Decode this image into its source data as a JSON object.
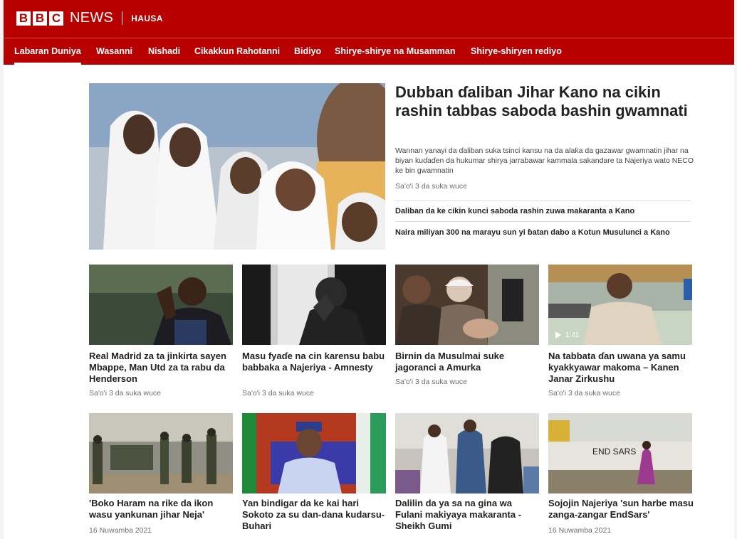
{
  "brand": {
    "b1": "B",
    "b2": "B",
    "b3": "C",
    "news": "NEWS",
    "lang": "HAUSA"
  },
  "nav": [
    {
      "label": "Labaran Duniya",
      "active": true
    },
    {
      "label": "Wasanni"
    },
    {
      "label": "Nishadi"
    },
    {
      "label": "Cikakkun Rahotanni"
    },
    {
      "label": "Bidiyo"
    },
    {
      "label": "Shirye-shirye na Musamman"
    },
    {
      "label": "Shirye-shiryen rediyo"
    }
  ],
  "top_story": {
    "headline": "Dubban ɗaliban Jihar Kano na cikin rashin tabbas saboda bashin gwamnati",
    "summary": "Wannan yanayi da ɗaliban suka tsinci kansu na da alaƙa da gazawar gwamnatin jihar na biyan kuɗaɗen da hukumar shirya jarrabawar kammala sakandare ta Najeriya wato NECO ke bin gwamnatin",
    "timestamp": "Sa'o'i 3 da suka wuce",
    "related": [
      "Daliban da ke cikin kunci saboda rashin zuwa makaranta a Kano",
      "Naira miliyan 300 na marayu sun yi ɓatan dabo a Kotun Musulunci a Kano"
    ]
  },
  "row1": [
    {
      "title": "Real Madrid za ta jinkirta sayen Mbappe, Man Utd za ta rabu da Henderson",
      "timestamp": "Sa'o'i 3 da suka wuce"
    },
    {
      "title": "Masu fyaɗe na cin karensu babu babbaka a Najeriya - Amnesty",
      "timestamp": "Sa'o'i 3 da suka wuce"
    },
    {
      "title": "Birnin da Musulmai suke jagoranci a Amurka",
      "timestamp": "Sa'o'i 3 da suka wuce"
    },
    {
      "title": "Na tabbata ɗan uwana ya samu kyakkyawar makoma – Kanen Janar Zirkushu",
      "timestamp": "Sa'o'i 3 da suka wuce",
      "duration": "1:41"
    }
  ],
  "row2": [
    {
      "title": "'Boko Haram na rike da ikon wasu yankunan jihar Neja'",
      "timestamp": "16 Nuwamba 2021"
    },
    {
      "title": "Yan bindigar da ke kai hari Sokoto za su dan-dana kudarsu- Buhari",
      "timestamp": ""
    },
    {
      "title": "Dalilin da ya sa na gina wa Fulani makiyaya makaranta - Sheikh Gumi",
      "timestamp": ""
    },
    {
      "title": "Sojojin Najeriya 'sun harbe masu zanga-zangar EndSars'",
      "timestamp": "16 Nuwamba 2021",
      "sign_text": "END SARS"
    }
  ],
  "colors": {
    "brand_red": "#b80000",
    "text": "#222222",
    "muted": "#6e6e6e"
  },
  "icons": {
    "video_play": "play-icon"
  }
}
